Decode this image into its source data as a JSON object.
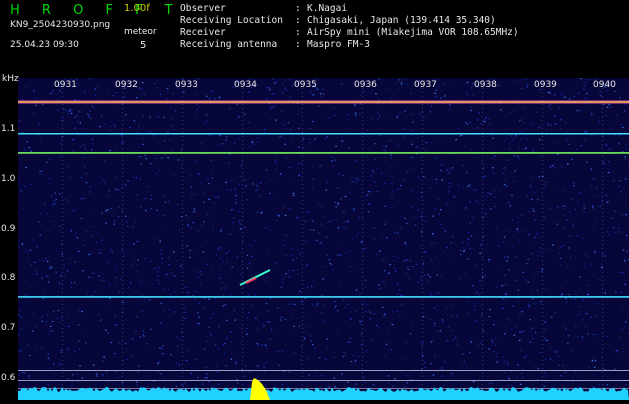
{
  "header": {
    "title": "H R O F F T",
    "version": "1.00f",
    "filename": "KN9_2504230930.png",
    "datetime": "25.04.23 09:30",
    "meteor_label": "meteor",
    "meteor_count": "5"
  },
  "station": {
    "rows": [
      {
        "key": "Observer",
        "value": "K.Nagai"
      },
      {
        "key": "Receiving Location",
        "value": "Chigasaki, Japan (139.414 35.340)"
      },
      {
        "key": "Receiver",
        "value": "AirSpy mini (Miakejima VOR 108.65MHz)"
      },
      {
        "key": "Receiving antenna",
        "value": "Maspro FM-3"
      }
    ]
  },
  "axis": {
    "unit": "kHz",
    "y_ticks": [
      "1.1",
      "1.0",
      "0.9",
      "0.8",
      "0.7",
      "0.6"
    ],
    "time_ticks": [
      "0931",
      "0932",
      "0933",
      "0934",
      "0935",
      "0936",
      "0937",
      "0938",
      "0939",
      "0940"
    ]
  },
  "colors": {
    "background": "#000000",
    "plot_bg": "#06063a",
    "title": "#00d800",
    "version": "#c8c800",
    "text": "#e8e8e8",
    "line_cyan": "#40e0ff",
    "trace_yellow": "#ffff00"
  }
}
